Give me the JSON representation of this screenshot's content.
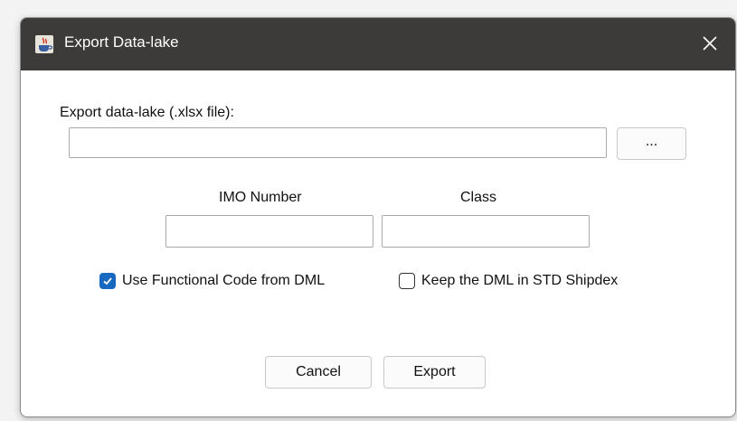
{
  "window": {
    "title": "Export Data-lake",
    "app_icon": "java-cup-icon",
    "close_icon": "close-icon"
  },
  "export": {
    "label": "Export data-lake (.xlsx file):",
    "path_value": "",
    "browse_label": "..."
  },
  "fields": {
    "imo_label": "IMO Number",
    "imo_value": "",
    "class_label": "Class",
    "class_value": ""
  },
  "options": {
    "functional_code_label": "Use Functional Code from DML",
    "functional_code_checked": true,
    "keep_dml_label": "Keep the DML in STD Shipdex",
    "keep_dml_checked": false
  },
  "buttons": {
    "cancel": "Cancel",
    "export": "Export"
  },
  "colors": {
    "titlebar": "#3c3b39",
    "checkbox_accent": "#1768c0"
  }
}
